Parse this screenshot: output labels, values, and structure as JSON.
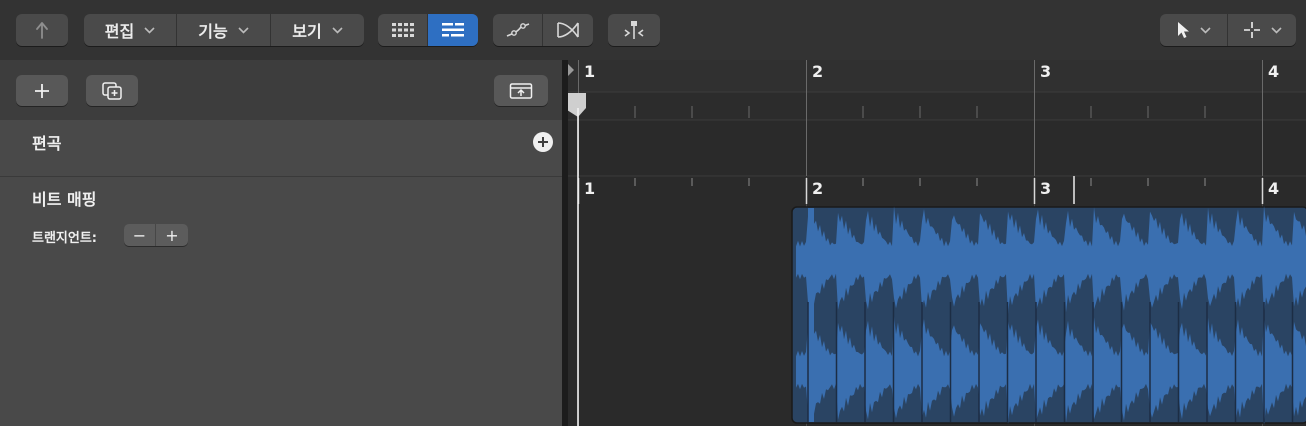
{
  "toolbar": {
    "menus": {
      "edit": "편집",
      "functions": "기능",
      "view": "보기"
    },
    "icons": {
      "back": "back-arrow-icon",
      "grid_view": "grid-view-icon",
      "list_view": "list-view-icon",
      "curve": "curve-automation-icon",
      "crossfade": "crossfade-icon",
      "snap": "snap-split-icon",
      "pointer_tool": "pointer-tool-icon",
      "marquee_tool": "crosshair-tool-icon"
    },
    "active_view": "list"
  },
  "left_panel": {
    "arrangement_title": "편곡",
    "beat_mapping_title": "비트 매핑",
    "transient_label": "트랜지언트:",
    "transient_minus": "−",
    "transient_plus": "+",
    "add_button": "+"
  },
  "ruler": {
    "top_bars": [
      "1",
      "2",
      "3",
      "4"
    ],
    "beat_bars": [
      "1",
      "2",
      "3",
      "4"
    ]
  },
  "colors": {
    "accent": "#2e6fc2",
    "waveform": "#3a6fb0",
    "waveform_dark": "#2a4463",
    "toolbar_bg": "#333333",
    "panel_bg": "#494949"
  }
}
